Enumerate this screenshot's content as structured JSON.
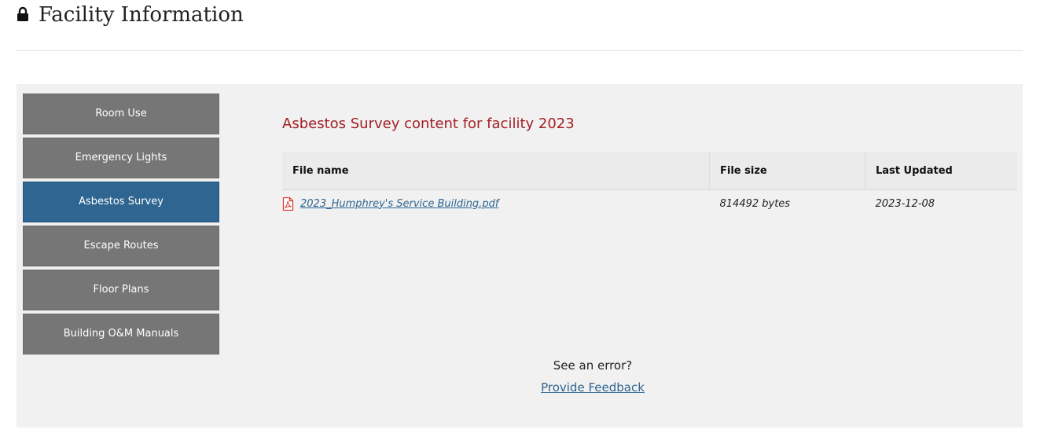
{
  "header": {
    "title": "Facility Information",
    "icon": "lock-icon"
  },
  "sidebar": {
    "items": [
      {
        "label": "Room Use",
        "active": false
      },
      {
        "label": "Emergency Lights",
        "active": false
      },
      {
        "label": "Asbestos Survey",
        "active": true
      },
      {
        "label": "Escape Routes",
        "active": false
      },
      {
        "label": "Floor Plans",
        "active": false
      },
      {
        "label": "Building O&M Manuals",
        "active": false
      }
    ]
  },
  "content": {
    "title": "Asbestos Survey content for facility 2023",
    "table": {
      "columns": [
        "File name",
        "File size",
        "Last Updated"
      ],
      "rows": [
        {
          "file_name": "2023_Humphrey's Service Building.pdf",
          "file_icon": "pdf-icon",
          "file_size": "814492 bytes",
          "last_updated": "2023-12-08"
        }
      ]
    }
  },
  "feedback": {
    "prompt": "See an error?",
    "link_label": "Provide Feedback"
  },
  "colors": {
    "title_accent": "#a31f24",
    "nav_default": "#767676",
    "nav_active": "#2e6591",
    "link": "#2e6591",
    "panel_bg": "#f1f1f1"
  }
}
